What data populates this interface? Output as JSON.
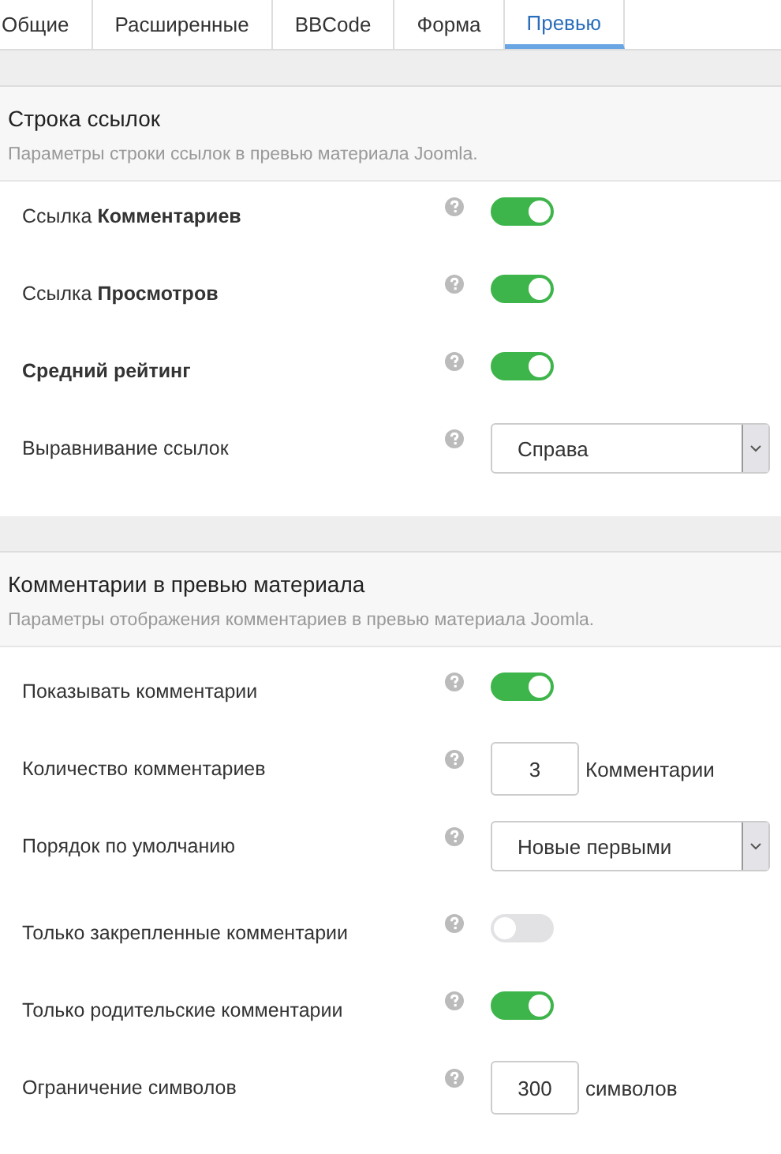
{
  "tabs": [
    {
      "label": "Общие",
      "selected": false
    },
    {
      "label": "Расширенные",
      "selected": false
    },
    {
      "label": "BBCode",
      "selected": false
    },
    {
      "label": "Форма",
      "selected": false
    },
    {
      "label": "Превью",
      "selected": true
    }
  ],
  "sections": [
    {
      "title": "Строка ссылок",
      "description": "Параметры строки ссылок в превью материала Joomla.",
      "rows": [
        {
          "kind": "toggle",
          "label": "Ссылка **Комментариев**",
          "bold": false,
          "on": true
        },
        {
          "kind": "toggle",
          "label": "Ссылка **Просмотров**",
          "bold": false,
          "on": true
        },
        {
          "kind": "toggle",
          "label": "Средний рейтинг",
          "bold": true,
          "on": true
        },
        {
          "kind": "select",
          "label": "Выравнивание ссылок",
          "bold": false,
          "value": "Справа"
        }
      ]
    },
    {
      "title": "Комментарии в превью материала",
      "description": "Параметры отображения комментариев в превью материала Joomla.",
      "rows": [
        {
          "kind": "toggle",
          "label": "Показывать комментарии",
          "bold": false,
          "on": true
        },
        {
          "kind": "number",
          "label": "Количество комментариев",
          "bold": false,
          "value": "3",
          "suffix": "Комментарии"
        },
        {
          "kind": "select",
          "label": "Порядок по умолчанию",
          "bold": false,
          "value": "Новые первыми"
        },
        {
          "kind": "toggle",
          "label": "Только закрепленные комментарии",
          "bold": false,
          "on": false
        },
        {
          "kind": "toggle",
          "label": "Только родительские комментарии",
          "bold": false,
          "on": true
        },
        {
          "kind": "number",
          "label": "Ограничение символов",
          "bold": false,
          "value": "300",
          "suffix": "символов"
        }
      ]
    }
  ]
}
